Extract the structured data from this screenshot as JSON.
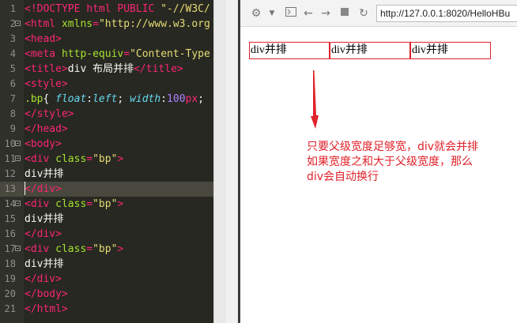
{
  "editor": {
    "lines": [
      {
        "n": "1",
        "fold": false,
        "parts": [
          [
            "tag",
            "<!DOCTYPE html PUBLIC "
          ],
          [
            "str",
            "\"-//W3C/"
          ]
        ]
      },
      {
        "n": "2",
        "fold": true,
        "parts": [
          [
            "tag",
            "<html "
          ],
          [
            "attr",
            "xmlns"
          ],
          [
            "tag",
            "="
          ],
          [
            "str",
            "\"http://www.w3.org"
          ]
        ]
      },
      {
        "n": "3",
        "fold": false,
        "parts": [
          [
            "tag",
            "<head>"
          ]
        ]
      },
      {
        "n": "4",
        "fold": false,
        "parts": [
          [
            "tag",
            "<meta "
          ],
          [
            "attr",
            "http-equiv"
          ],
          [
            "tag",
            "="
          ],
          [
            "str",
            "\"Content-Type"
          ]
        ]
      },
      {
        "n": "5",
        "fold": false,
        "parts": [
          [
            "tag",
            "<title>"
          ],
          [
            "txt",
            "div 布局并排"
          ],
          [
            "tag",
            "</title>"
          ]
        ]
      },
      {
        "n": "6",
        "fold": false,
        "parts": [
          [
            "tag",
            "<style>"
          ]
        ]
      },
      {
        "n": "7",
        "fold": false,
        "parts": [
          [
            "cls",
            ".bp"
          ],
          [
            "txt",
            "{ "
          ],
          [
            "prop",
            "float"
          ],
          [
            "txt",
            ":"
          ],
          [
            "prop",
            "left"
          ],
          [
            "txt",
            "; "
          ],
          [
            "prop",
            "width"
          ],
          [
            "txt",
            ":"
          ],
          [
            "num",
            "100"
          ],
          [
            "tag",
            "px"
          ],
          [
            "txt",
            ";"
          ]
        ]
      },
      {
        "n": "8",
        "fold": false,
        "parts": [
          [
            "tag",
            "</style>"
          ]
        ]
      },
      {
        "n": "9",
        "fold": false,
        "parts": [
          [
            "tag",
            "</head>"
          ]
        ]
      },
      {
        "n": "10",
        "fold": true,
        "parts": [
          [
            "tag",
            "<body>"
          ]
        ]
      },
      {
        "n": "11",
        "fold": true,
        "parts": [
          [
            "tag",
            "<div "
          ],
          [
            "attr",
            "class"
          ],
          [
            "tag",
            "="
          ],
          [
            "str",
            "\"bp\""
          ],
          [
            "tag",
            ">"
          ]
        ]
      },
      {
        "n": "12",
        "fold": false,
        "parts": [
          [
            "txt",
            "div并排"
          ]
        ]
      },
      {
        "n": "13",
        "fold": false,
        "active": true,
        "parts": [
          [
            "tag",
            "</div>"
          ]
        ]
      },
      {
        "n": "14",
        "fold": true,
        "parts": [
          [
            "tag",
            "<div "
          ],
          [
            "attr",
            "class"
          ],
          [
            "tag",
            "="
          ],
          [
            "str",
            "\"bp\""
          ],
          [
            "tag",
            ">"
          ]
        ]
      },
      {
        "n": "15",
        "fold": false,
        "parts": [
          [
            "txt",
            "div并排"
          ]
        ]
      },
      {
        "n": "16",
        "fold": false,
        "parts": [
          [
            "tag",
            "</div>"
          ]
        ]
      },
      {
        "n": "17",
        "fold": true,
        "parts": [
          [
            "tag",
            "<div "
          ],
          [
            "attr",
            "class"
          ],
          [
            "tag",
            "="
          ],
          [
            "str",
            "\"bp\""
          ],
          [
            "tag",
            ">"
          ]
        ]
      },
      {
        "n": "18",
        "fold": false,
        "parts": [
          [
            "txt",
            "div并排"
          ]
        ]
      },
      {
        "n": "19",
        "fold": false,
        "parts": [
          [
            "tag",
            "</div>"
          ]
        ]
      },
      {
        "n": "20",
        "fold": false,
        "parts": [
          [
            "tag",
            "</body>"
          ]
        ]
      },
      {
        "n": "21",
        "fold": false,
        "parts": [
          [
            "tag",
            "</html>"
          ]
        ]
      }
    ]
  },
  "browser": {
    "toolbar": {
      "settings_icon": "gear-icon",
      "dropdown_icon": "caret-down-icon",
      "devtools_icon": "console-icon",
      "back_icon": "arrow-left-icon",
      "forward_icon": "arrow-right-icon",
      "stop_icon": "stop-icon",
      "refresh_icon": "refresh-icon"
    },
    "address": "http://127.0.0.1:8020/HelloHBu",
    "boxes": [
      "div并排",
      "div并排",
      "div并排"
    ],
    "annotation": [
      "只要父级宽度足够宽，div就会并排",
      "如果宽度之和大于父级宽度，那么",
      "div会自动换行"
    ],
    "accent_color": "#e0222a"
  }
}
